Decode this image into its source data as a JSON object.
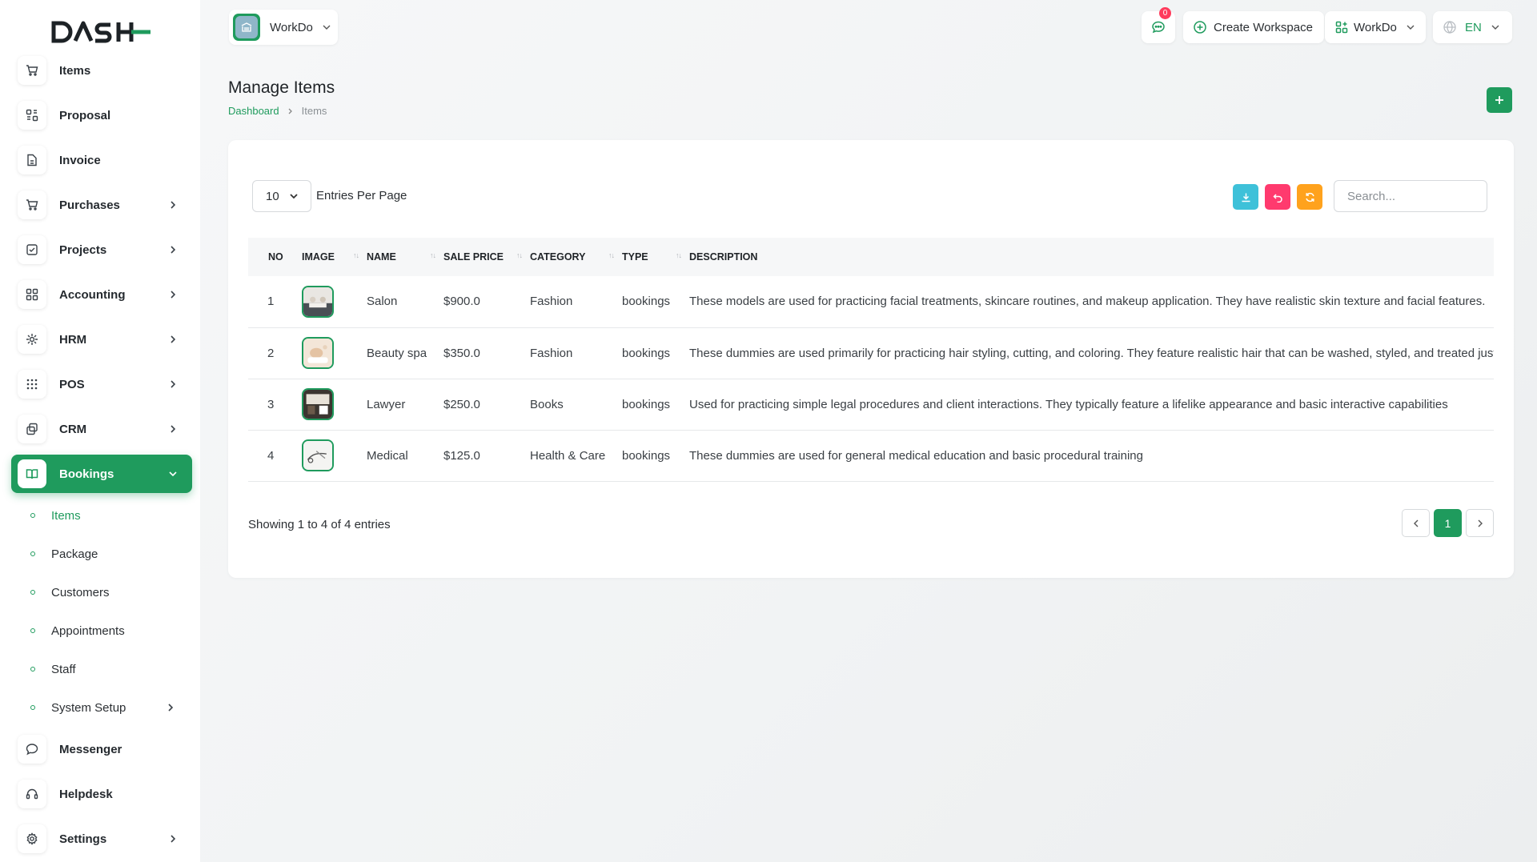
{
  "brand": {
    "logo_text": "DASH"
  },
  "header": {
    "workspace_name": "WorkDo",
    "notification_count": "0",
    "create_workspace_label": "Create Workspace",
    "workspace_menu_label": "WorkDo",
    "language_label": "EN"
  },
  "sidebar": {
    "items": [
      {
        "label": "Items",
        "icon": "cart-icon"
      },
      {
        "label": "Proposal",
        "icon": "proposal-icon"
      },
      {
        "label": "Invoice",
        "icon": "file-icon"
      },
      {
        "label": "Purchases",
        "icon": "cart-icon"
      },
      {
        "label": "Projects",
        "icon": "checkbox-icon"
      },
      {
        "label": "Accounting",
        "icon": "grid-icon"
      },
      {
        "label": "HRM",
        "icon": "hrm-icon"
      },
      {
        "label": "POS",
        "icon": "dots-grid-icon"
      },
      {
        "label": "CRM",
        "icon": "copy-icon"
      },
      {
        "label": "Bookings",
        "icon": "book-icon"
      },
      {
        "label": "Messenger",
        "icon": "chat-icon"
      },
      {
        "label": "Helpdesk",
        "icon": "headset-icon"
      },
      {
        "label": "Settings",
        "icon": "gear-icon"
      }
    ],
    "bookings_sub": [
      {
        "label": "Items"
      },
      {
        "label": "Package"
      },
      {
        "label": "Customers"
      },
      {
        "label": "Appointments"
      },
      {
        "label": "Staff"
      },
      {
        "label": "System Setup"
      }
    ]
  },
  "page": {
    "title": "Manage Items",
    "breadcrumb": {
      "home": "Dashboard",
      "current": "Items"
    }
  },
  "table_controls": {
    "per_page_value": "10",
    "per_page_label": "Entries Per Page",
    "search_placeholder": "Search..."
  },
  "table": {
    "columns": [
      "NO",
      "IMAGE",
      "NAME",
      "SALE PRICE",
      "CATEGORY",
      "TYPE",
      "DESCRIPTION"
    ],
    "rows": [
      {
        "no": "1",
        "name": "Salon",
        "price": "$900.0",
        "category": "Fashion",
        "type": "bookings",
        "description": "These models are used for practicing facial treatments, skincare routines, and makeup application. They have realistic skin texture and facial features."
      },
      {
        "no": "2",
        "name": "Beauty spa",
        "price": "$350.0",
        "category": "Fashion",
        "type": "bookings",
        "description": "These dummies are used primarily for practicing hair styling, cutting, and coloring. They feature realistic hair that can be washed, styled, and treated just like real hair."
      },
      {
        "no": "3",
        "name": "Lawyer",
        "price": "$250.0",
        "category": "Books",
        "type": "bookings",
        "description": "Used for practicing simple legal procedures and client interactions. They typically feature a lifelike appearance and basic interactive capabilities"
      },
      {
        "no": "4",
        "name": "Medical",
        "price": "$125.0",
        "category": "Health & Care",
        "type": "bookings",
        "description": "These dummies are used for general medical education and basic procedural training"
      }
    ]
  },
  "pagination": {
    "summary": "Showing 1 to 4 of 4 entries",
    "current_page": "1"
  },
  "colors": {
    "primary": "#1f9b5d",
    "export": "#3ec1d9",
    "back": "#ff3a6e",
    "refresh": "#ffa21d"
  }
}
